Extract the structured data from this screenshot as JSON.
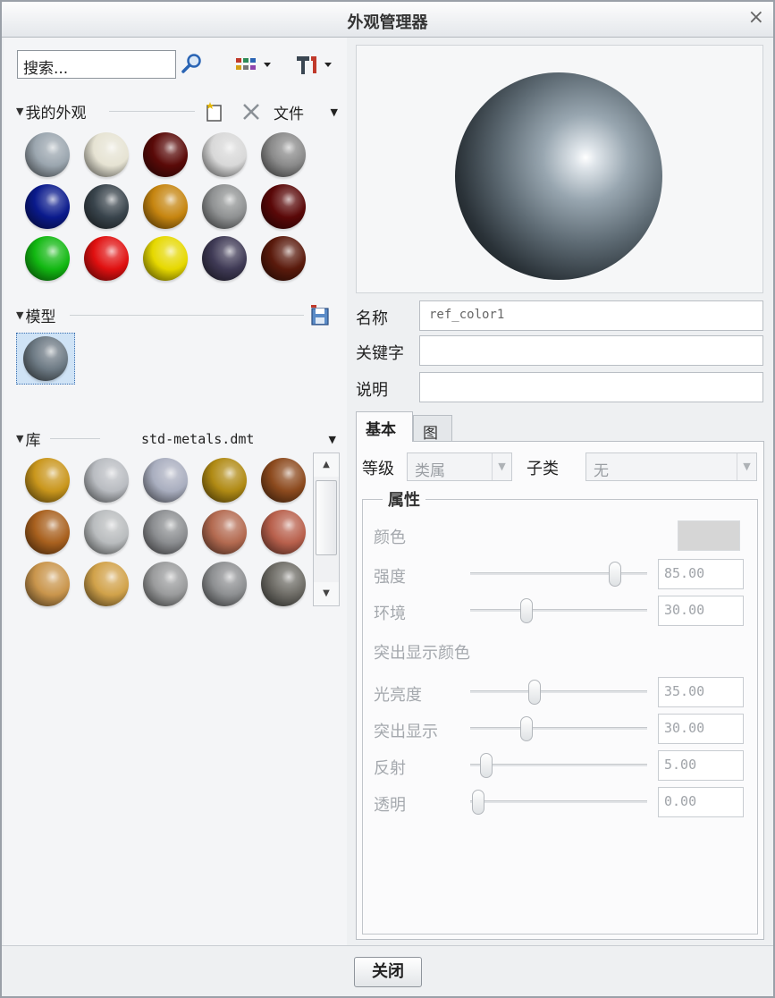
{
  "window": {
    "title": "外观管理器",
    "close_glyph": "×"
  },
  "search": {
    "placeholder": "搜索..."
  },
  "toolbar": {
    "file_menu": "文件"
  },
  "sections": {
    "my_appearances": "我的外观",
    "model": "模型",
    "library": "库",
    "library_file": "std-metals.dmt"
  },
  "colors": {
    "my_appearances": [
      "#9ba6af",
      "#e6e3d3",
      "#5a0a08",
      "#d8d8d8",
      "#8a8a8a",
      "#0a1a8c",
      "#39444c",
      "#c68510",
      "#8f9192",
      "#5a0808",
      "#12b812",
      "#e01010",
      "#e6d800",
      "#3f3a55",
      "#5a1a0c"
    ],
    "model": [
      "#6d7a84"
    ],
    "library": [
      "#c9961c",
      "#b9bcc1",
      "#a9aebf",
      "#b08a14",
      "#8c4a1e",
      "#a8601e",
      "#b9bcbe",
      "#8b8d90",
      "#b36a50",
      "#b8604c",
      "#c9954c",
      "#d1a24a",
      "#9a9b9c",
      "#8d8f91",
      "#6e6c66"
    ]
  },
  "properties_form": {
    "name_label": "名称",
    "name_value": "ref_color1",
    "keyword_label": "关键字",
    "keyword_value": "",
    "desc_label": "说明",
    "desc_value": ""
  },
  "tabs": [
    {
      "label": "基本",
      "active": true
    },
    {
      "label": "图",
      "active": false
    }
  ],
  "basic": {
    "class_label": "等级",
    "class_value": "类属",
    "subclass_label": "子类",
    "subclass_value": "无",
    "group_title": "属性",
    "color_label": "颜色",
    "highlight_color_label": "突出显示颜色",
    "sliders": [
      {
        "label": "强度",
        "value": "85.00",
        "level": 0.85
      },
      {
        "label": "环境",
        "value": "30.00",
        "level": 0.3
      },
      {
        "label": "光亮度",
        "value": "35.00",
        "level": 0.35
      },
      {
        "label": "突出显示",
        "value": "30.00",
        "level": 0.3
      },
      {
        "label": "反射",
        "value": "5.00",
        "level": 0.05
      },
      {
        "label": "透明",
        "value": "0.00",
        "level": 0.0
      }
    ]
  },
  "footer": {
    "close_label": "关闭"
  }
}
